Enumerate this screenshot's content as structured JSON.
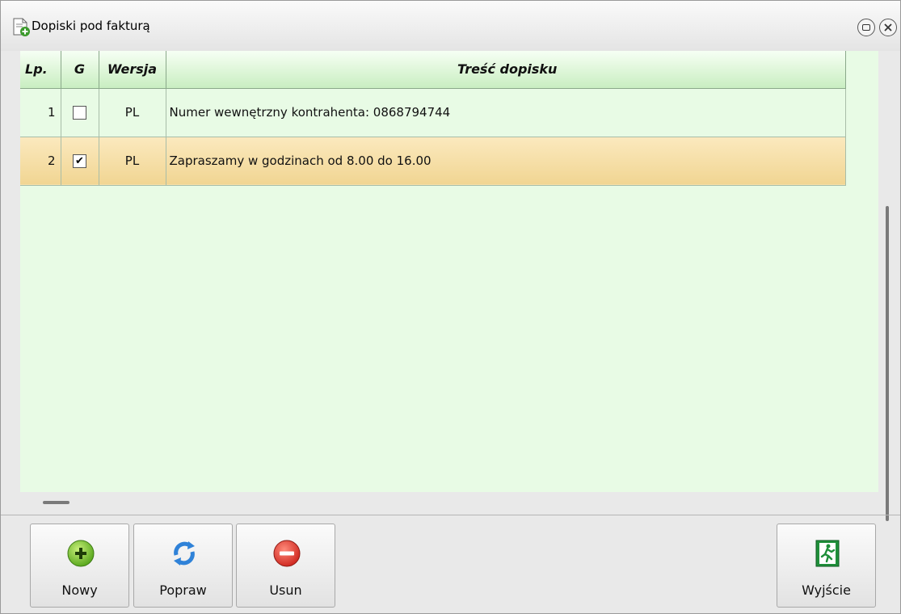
{
  "window": {
    "title": "Dopiski pod fakturą"
  },
  "grid": {
    "columns": [
      "Lp.",
      "G",
      "Wersja",
      "Treść dopisku"
    ],
    "rows": [
      {
        "lp": "1",
        "checked": false,
        "check_glyph": "",
        "wersja": "PL",
        "tresc": "Numer wewnętrzny kontrahenta: 0868794744"
      },
      {
        "lp": "2",
        "checked": true,
        "check_glyph": "✔",
        "wersja": "PL",
        "tresc": "Zapraszamy w godzinach od 8.00 do 16.00"
      }
    ]
  },
  "toolbar": {
    "nowy_label": "Nowy",
    "popraw_label": "Popraw",
    "usun_label": "Usun",
    "wyjscie_label": "Wyjście"
  },
  "colors": {
    "grid_bg": "#e8fbe5",
    "header_green": "#c9eec1",
    "selected_row": "#f1d592",
    "add_green": "#6cbf2a",
    "delete_red": "#d9312b",
    "refresh_blue": "#2f82d8",
    "exit_green": "#1f8f3a"
  },
  "icons": {
    "title": "document-add-icon",
    "nowy": "plus-circle-icon",
    "popraw": "refresh-icon",
    "usun": "minus-circle-icon",
    "wyjscie": "exit-door-icon"
  }
}
